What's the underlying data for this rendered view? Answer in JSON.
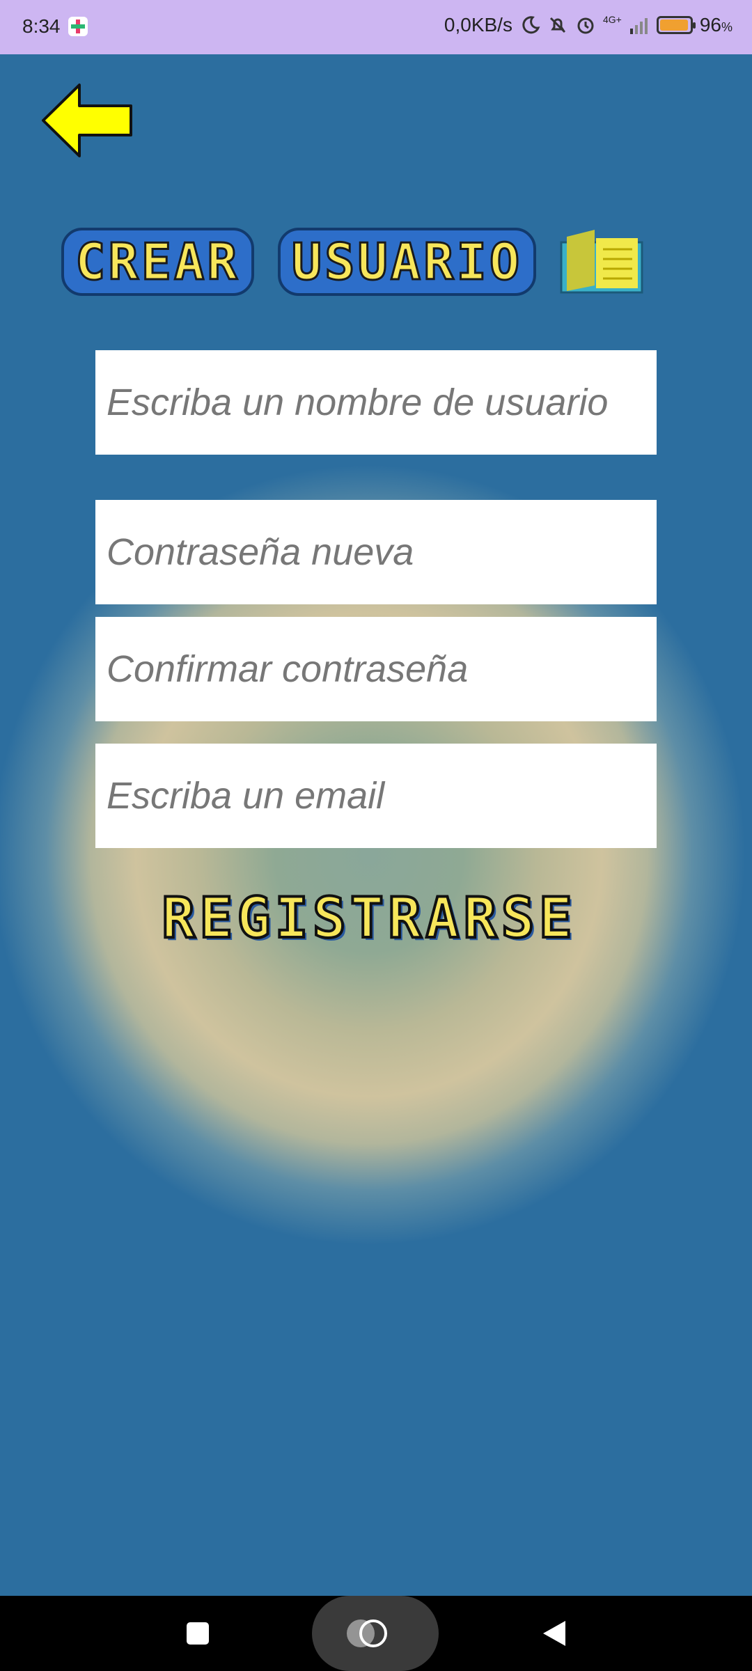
{
  "status_bar": {
    "time": "8:34",
    "network_speed": "0,0KB/s",
    "signal_type": "4G+",
    "battery_percent": "96",
    "battery_unit": "%",
    "battery_level": 0.96,
    "icons": [
      "moon-icon",
      "silent-icon",
      "alarm-icon",
      "signal-icon",
      "battery-icon"
    ]
  },
  "header": {
    "back_icon": "arrow-left-icon",
    "title_word_1": "CREAR",
    "title_word_2": "USUARIO",
    "title_icon": "book-icon"
  },
  "form": {
    "username": {
      "placeholder": "Escriba un nombre de usuario",
      "value": ""
    },
    "new_password": {
      "placeholder": "Contraseña nueva",
      "value": ""
    },
    "confirm_password": {
      "placeholder": "Confirmar contraseña",
      "value": ""
    },
    "email": {
      "placeholder": "Escriba un email",
      "value": ""
    },
    "submit_label": "REGISTRARSE"
  },
  "nav_bar": {
    "icons": [
      "recents-icon",
      "home-icon",
      "back-icon"
    ]
  },
  "colors": {
    "status_bar_bg": "#cdb6f2",
    "title_yellow": "#f7e65b",
    "arrow_yellow": "#ffff00",
    "background_blue": "#2c6e9f",
    "background_beige": "#cfc39e"
  }
}
